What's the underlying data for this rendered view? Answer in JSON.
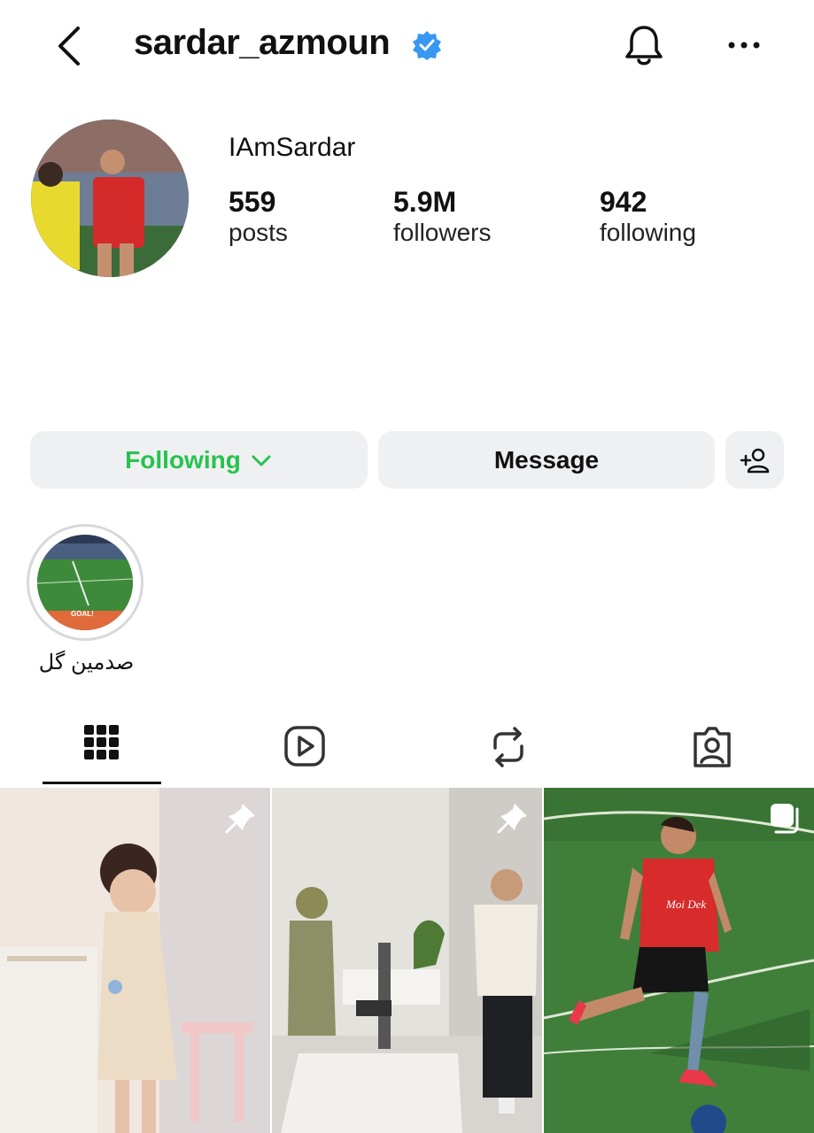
{
  "header": {
    "username": "sardar_azmoun",
    "icons": [
      "chevron-left-icon",
      "verified-badge-icon",
      "bell-icon",
      "more-horizontal-icon"
    ]
  },
  "profile": {
    "full_name": "IAmSardar",
    "stats": [
      {
        "value": "559",
        "label": "posts"
      },
      {
        "value": "5.9M",
        "label": "followers"
      },
      {
        "value": "942",
        "label": "following"
      }
    ]
  },
  "actions": {
    "following_label": "Following",
    "message_label": "Message",
    "add_icon": "person-add-icon"
  },
  "highlights": [
    {
      "label": "صدمین گل",
      "image_text": "GOAL!"
    }
  ],
  "tabs": [
    {
      "icon": "grid-icon",
      "active": true
    },
    {
      "icon": "reels-icon",
      "active": false
    },
    {
      "icon": "reposts-icon",
      "active": false
    },
    {
      "icon": "tagged-icon",
      "active": false
    }
  ],
  "posts": [
    {
      "badge": "pin-icon"
    },
    {
      "badge": "pin-icon"
    },
    {
      "badge": "carousel-icon",
      "jersey_text": "Moi Dek"
    }
  ],
  "colors": {
    "accent_green": "#28c24f",
    "verified_blue": "#3897f0",
    "button_bg": "#eff0f2"
  }
}
